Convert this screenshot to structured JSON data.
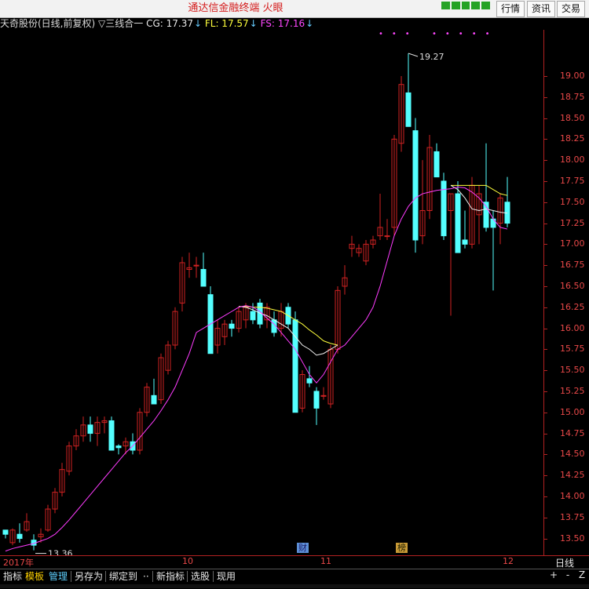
{
  "app": {
    "title": "通达信金融终端 火眼",
    "buttons": [
      "行情",
      "资讯",
      "交易"
    ]
  },
  "legend": {
    "stock": "天奇股份(日线,前复权)",
    "indicator": "▽三线合一",
    "cg_label": "CG: 17.37",
    "fl_label": "FL: 17.57",
    "fs_label": "FS: 17.16",
    "arrow": "↓"
  },
  "colors": {
    "up": "#d02222",
    "down": "#54ffff",
    "fs_line": "#ff3cff",
    "fl_line": "#ffff3c",
    "cg_line": "#f0f0f0",
    "axis": "#b22222"
  },
  "annotations": {
    "high": "19.27",
    "low": "13.36"
  },
  "yaxis": {
    "ticks": [
      "19.00",
      "18.75",
      "18.50",
      "18.25",
      "18.00",
      "17.75",
      "17.50",
      "17.25",
      "17.00",
      "16.75",
      "16.50",
      "16.25",
      "16.00",
      "15.75",
      "15.50",
      "15.25",
      "15.00",
      "14.75",
      "14.50",
      "14.25",
      "14.00",
      "13.75",
      "13.50"
    ]
  },
  "xaxis": {
    "labels": [
      "2017年",
      "10",
      "11",
      "12"
    ],
    "period": "日线"
  },
  "badges": {
    "cai": "财",
    "bang": "榜"
  },
  "toolbar": {
    "items": [
      "指标",
      "模板",
      "管理",
      "另存为",
      "绑定到",
      "··",
      "新指标",
      "选股",
      "现用"
    ],
    "nav": [
      "+",
      "-",
      "Z"
    ]
  },
  "chart_data": {
    "type": "candlestick",
    "ylim": [
      13.3,
      19.55
    ],
    "ohlc": [
      [
        13.6,
        13.6,
        13.5,
        13.55
      ],
      [
        13.45,
        13.62,
        13.42,
        13.6
      ],
      [
        13.55,
        13.68,
        13.45,
        13.5
      ],
      [
        13.6,
        13.8,
        13.58,
        13.7
      ],
      [
        13.48,
        13.55,
        13.36,
        13.42
      ],
      [
        13.52,
        13.62,
        13.45,
        13.55
      ],
      [
        13.6,
        13.9,
        13.58,
        13.85
      ],
      [
        13.85,
        14.1,
        13.8,
        14.05
      ],
      [
        14.05,
        14.4,
        14.0,
        14.32
      ],
      [
        14.3,
        14.65,
        14.25,
        14.6
      ],
      [
        14.6,
        14.8,
        14.55,
        14.72
      ],
      [
        14.72,
        14.95,
        14.65,
        14.85
      ],
      [
        14.85,
        14.95,
        14.65,
        14.75
      ],
      [
        14.75,
        14.95,
        14.6,
        14.88
      ],
      [
        14.88,
        14.95,
        14.75,
        14.9
      ],
      [
        14.9,
        14.95,
        14.6,
        14.55
      ],
      [
        14.6,
        14.62,
        14.5,
        14.58
      ],
      [
        14.6,
        14.7,
        14.5,
        14.65
      ],
      [
        14.65,
        14.75,
        14.5,
        14.55
      ],
      [
        14.55,
        15.05,
        14.5,
        15.0
      ],
      [
        15.0,
        15.35,
        14.95,
        15.3
      ],
      [
        15.2,
        15.4,
        15.1,
        15.1
      ],
      [
        15.15,
        15.7,
        15.1,
        15.65
      ],
      [
        15.5,
        15.85,
        15.45,
        15.8
      ],
      [
        15.8,
        16.25,
        15.75,
        16.2
      ],
      [
        16.3,
        16.85,
        16.2,
        16.78
      ],
      [
        16.7,
        16.9,
        16.6,
        16.72
      ],
      [
        16.75,
        16.85,
        16.6,
        16.75
      ],
      [
        16.7,
        16.9,
        16.6,
        16.5
      ],
      [
        16.4,
        16.5,
        15.7,
        15.7
      ],
      [
        15.8,
        16.1,
        15.7,
        16.0
      ],
      [
        15.9,
        16.1,
        15.8,
        16.05
      ],
      [
        16.05,
        16.1,
        15.9,
        16.0
      ],
      [
        16.0,
        16.25,
        15.95,
        16.2
      ],
      [
        16.1,
        16.3,
        16.0,
        16.25
      ],
      [
        16.2,
        16.3,
        16.05,
        16.1
      ],
      [
        16.3,
        16.35,
        16.0,
        16.05
      ],
      [
        16.1,
        16.3,
        16.0,
        16.25
      ],
      [
        16.1,
        16.2,
        15.9,
        15.95
      ],
      [
        16.0,
        16.3,
        15.9,
        16.2
      ],
      [
        16.25,
        16.3,
        16.0,
        16.05
      ],
      [
        16.1,
        16.2,
        15.0,
        15.0
      ],
      [
        15.05,
        15.5,
        15.0,
        15.45
      ],
      [
        15.4,
        15.55,
        15.3,
        15.35
      ],
      [
        15.25,
        15.3,
        14.85,
        15.05
      ],
      [
        15.2,
        15.3,
        15.15,
        15.2
      ],
      [
        15.1,
        15.8,
        15.05,
        15.75
      ],
      [
        15.75,
        16.5,
        15.7,
        16.45
      ],
      [
        16.5,
        16.75,
        16.4,
        16.6
      ],
      [
        16.95,
        17.1,
        16.85,
        17.0
      ],
      [
        16.9,
        17.0,
        16.85,
        16.95
      ],
      [
        16.8,
        17.05,
        16.75,
        17.0
      ],
      [
        17.0,
        17.1,
        16.95,
        17.05
      ],
      [
        17.1,
        17.6,
        17.05,
        17.2
      ],
      [
        17.1,
        17.3,
        17.05,
        17.1
      ],
      [
        17.2,
        18.3,
        17.1,
        18.25
      ],
      [
        18.2,
        19.0,
        18.1,
        18.9
      ],
      [
        18.8,
        19.27,
        18.4,
        18.4
      ],
      [
        18.35,
        18.5,
        16.9,
        17.05
      ],
      [
        17.1,
        18.0,
        17.0,
        17.4
      ],
      [
        17.4,
        18.3,
        17.3,
        18.15
      ],
      [
        18.1,
        18.2,
        17.8,
        17.8
      ],
      [
        17.75,
        17.85,
        17.05,
        17.1
      ],
      [
        17.4,
        17.6,
        16.15,
        17.6
      ],
      [
        17.6,
        17.75,
        16.9,
        16.9
      ],
      [
        17.05,
        17.4,
        16.95,
        17.0
      ],
      [
        17.0,
        17.8,
        16.95,
        17.7
      ],
      [
        17.35,
        17.7,
        17.0,
        17.6
      ],
      [
        17.5,
        18.2,
        17.15,
        17.2
      ],
      [
        17.3,
        17.4,
        16.45,
        17.2
      ],
      [
        17.25,
        17.6,
        17.0,
        17.55
      ],
      [
        17.5,
        17.8,
        17.2,
        17.25
      ]
    ],
    "fs": [
      13.35,
      13.38,
      13.4,
      13.42,
      13.44,
      13.47,
      13.5,
      13.55,
      13.63,
      13.72,
      13.82,
      13.92,
      14.02,
      14.12,
      14.22,
      14.32,
      14.42,
      14.52,
      14.6,
      14.7,
      14.8,
      14.9,
      15.02,
      15.15,
      15.3,
      15.5,
      15.7,
      15.95,
      16.0,
      16.05,
      16.1,
      16.15,
      16.2,
      16.25,
      16.27,
      16.25,
      16.2,
      16.12,
      16.05,
      15.95,
      15.85,
      15.75,
      15.6,
      15.45,
      15.35,
      15.45,
      15.6,
      15.75,
      15.8,
      15.9,
      16.0,
      16.1,
      16.25,
      16.5,
      16.8,
      17.1,
      17.3,
      17.45,
      17.55,
      17.6,
      17.62,
      17.64,
      17.65,
      17.66,
      17.68,
      17.67,
      17.62,
      17.55,
      17.45,
      17.3,
      17.2,
      17.18
    ],
    "fl": [
      null,
      null,
      null,
      null,
      null,
      null,
      null,
      null,
      null,
      null,
      null,
      null,
      null,
      null,
      null,
      null,
      null,
      null,
      null,
      null,
      null,
      null,
      null,
      null,
      null,
      null,
      null,
      null,
      null,
      null,
      null,
      null,
      null,
      16.26,
      16.26,
      16.25,
      16.25,
      16.24,
      16.22,
      16.2,
      16.15,
      16.1,
      16.05,
      15.98,
      15.92,
      15.85,
      15.82,
      15.8,
      null,
      null,
      null,
      null,
      null,
      null,
      null,
      null,
      null,
      null,
      null,
      null,
      null,
      null,
      null,
      17.7,
      17.7,
      17.7,
      17.7,
      17.7,
      17.7,
      17.65,
      17.6,
      17.58
    ],
    "cg": [
      null,
      null,
      null,
      null,
      null,
      null,
      null,
      null,
      null,
      null,
      null,
      null,
      null,
      null,
      null,
      null,
      null,
      null,
      null,
      null,
      null,
      null,
      null,
      null,
      null,
      null,
      null,
      null,
      null,
      null,
      null,
      null,
      null,
      16.26,
      16.25,
      16.22,
      16.18,
      16.15,
      16.1,
      16.05,
      16.0,
      15.9,
      15.8,
      15.75,
      15.68,
      15.7,
      15.75,
      15.8,
      null,
      null,
      null,
      null,
      null,
      null,
      null,
      null,
      null,
      null,
      null,
      null,
      null,
      null,
      null,
      17.7,
      17.65,
      17.55,
      17.42,
      17.4,
      17.42,
      17.4,
      17.38,
      17.37
    ]
  }
}
